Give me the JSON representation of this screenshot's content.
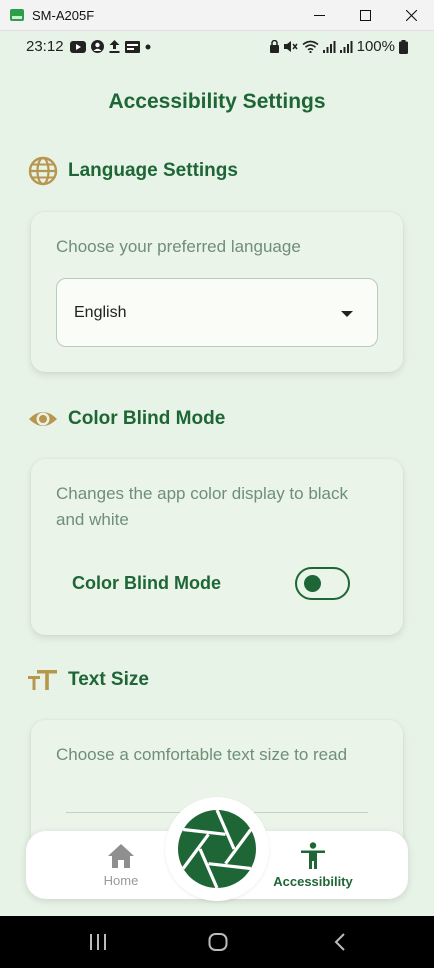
{
  "window": {
    "title": "SM-A205F"
  },
  "status": {
    "time": "23:12",
    "battery": "100%"
  },
  "page": {
    "title": "Accessibility Settings"
  },
  "language": {
    "heading": "Language Settings",
    "description": "Choose your preferred language",
    "selected": "English"
  },
  "colorblind": {
    "heading": "Color Blind Mode",
    "description": "Changes the app color display to black and white",
    "toggle_label": "Color Blind Mode",
    "enabled": false
  },
  "textsize": {
    "heading": "Text Size",
    "description": "Choose a comfortable text size to read"
  },
  "nav": {
    "home_label": "Home",
    "accessibility_label": "Accessibility"
  },
  "colors": {
    "primary": "#1e6636",
    "accent": "#b7964e",
    "background": "#e8f3e7"
  }
}
